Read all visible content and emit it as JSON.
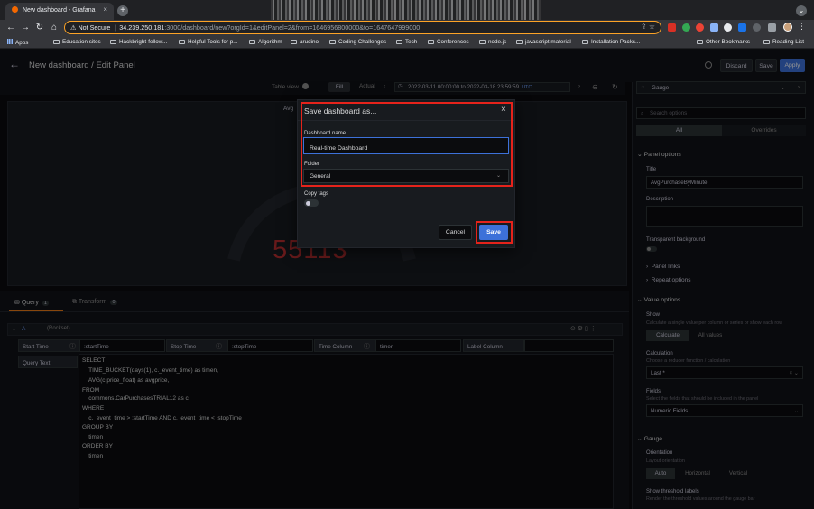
{
  "browser": {
    "tab_title": "New dashboard - Grafana",
    "tab_close": "×",
    "new_tab": "+",
    "url_warning": "Not Secure",
    "url_host": "34.239.250.181",
    "url_path": ":3000/dashboard/new?orgId=1&editPanel=2&from=1646956800000&to=1647647999000",
    "bookmarks": [
      "Apps",
      "Education sites",
      "Hackbright-fellow...",
      "Helpful Tools for p...",
      "Algorithm",
      "arudino",
      "Coding Challenges",
      "Tech",
      "Conferences",
      "node.js",
      "javascript material",
      "Installation Packs..."
    ],
    "other_bookmarks": "Other Bookmarks",
    "reading_list": "Reading List"
  },
  "grafana": {
    "page_title": "New dashboard / Edit Panel",
    "discard": "Discard",
    "save": "Save",
    "apply": "Apply",
    "table_view": "Table view",
    "fill": "Fill",
    "actual": "Actual",
    "time_range": "2022-03-11 00:00:00 to 2022-03-18 23:59:59",
    "time_zone": "UTC",
    "panel_title": "Avg",
    "gauge_value": "55113"
  },
  "query": {
    "tab_query": "Query",
    "tab_query_count": "1",
    "tab_transform": "Transform",
    "tab_transform_count": "0",
    "ref": "A",
    "datasource": "(Rockset)",
    "start_time_label": "Start Time",
    "start_time_value": ":startTime",
    "stop_time_label": "Stop Time",
    "stop_time_value": ":stopTime",
    "time_column_label": "Time Column",
    "time_column_value": "timen",
    "label_column_label": "Label Column",
    "label_column_value": "",
    "query_text_label": "Query Text",
    "sql_lines": [
      "SELECT",
      "    TIME_BUCKET(days(1), c._event_time) as timen,",
      "    AVG(c.price_float) as avgprice,",
      "FROM",
      "    commons.CarPurchasesTRIAL12 as c",
      "WHERE",
      "    c._event_time > :startTime AND c._event_time < :stopTime",
      "GROUP BY",
      "    timen",
      "ORDER BY",
      "    timen"
    ]
  },
  "options": {
    "viz": "Gauge",
    "search_placeholder": "Search options",
    "all": "All",
    "overrides": "Overrides",
    "panel_options": "Panel options",
    "title_label": "Title",
    "title_value": "AvgPurchaseByMinute",
    "description_label": "Description",
    "transparent_label": "Transparent background",
    "panel_links": "Panel links",
    "repeat_options": "Repeat options",
    "value_options": "Value options",
    "show_label": "Show",
    "show_desc": "Calculate a single value per column or series or show each row",
    "calculate": "Calculate",
    "all_values": "All values",
    "calc_label": "Calculation",
    "calc_desc": "Choose a reducer function / calculation",
    "calc_value": "Last *",
    "fields_label": "Fields",
    "fields_desc": "Select the fields that should be included in the panel",
    "fields_value": "Numeric Fields",
    "gauge_section": "Gauge",
    "orientation_label": "Orientation",
    "orientation_desc": "Layout orientation",
    "auto": "Auto",
    "horizontal": "Horizontal",
    "vertical": "Vertical",
    "threshold_labels": "Show threshold labels",
    "threshold_desc": "Render the threshold values around the gauge bar"
  },
  "modal": {
    "title": "Save dashboard as...",
    "close": "×",
    "name_label": "Dashboard name",
    "name_value": "Real-time Dashboard",
    "folder_label": "Folder",
    "folder_value": "General",
    "copy_tags_label": "Copy tags",
    "cancel": "Cancel",
    "save": "Save"
  },
  "colors": {
    "accent": "#3d71d9",
    "highlight": "#e5231b",
    "gauge_value": "#b32d2f"
  }
}
